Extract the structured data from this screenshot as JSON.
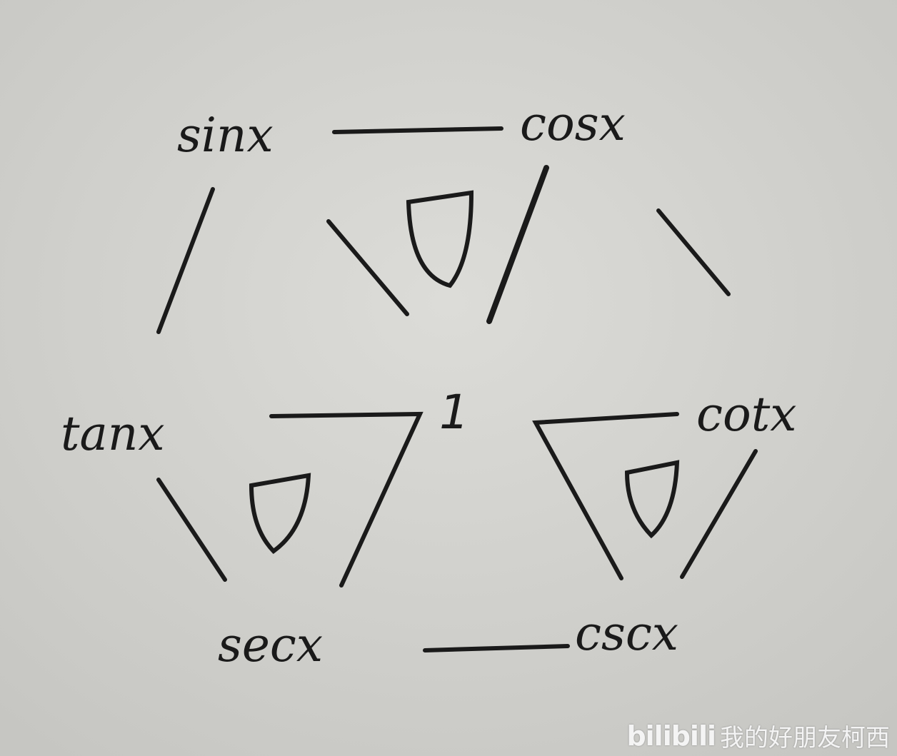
{
  "diagram": {
    "nodes": {
      "sin": "sinx",
      "cos": "cosx",
      "tan": "tanx",
      "cot": "cotx",
      "sec": "secx",
      "csc": "cscx",
      "center": "1"
    }
  },
  "watermark": {
    "logo": "bilibili",
    "author": "我的好朋友柯西"
  }
}
